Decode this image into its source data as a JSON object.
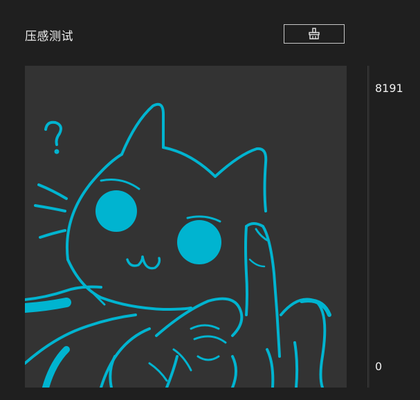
{
  "panel": {
    "title": "压感测试",
    "clear_button_icon": "broom-icon"
  },
  "pressure_meter": {
    "max_label": "8191",
    "min_label": "0",
    "current_level": 0
  },
  "colors": {
    "background": "#1f1f1f",
    "canvas": "#333333",
    "stroke": "#00b4d0"
  }
}
